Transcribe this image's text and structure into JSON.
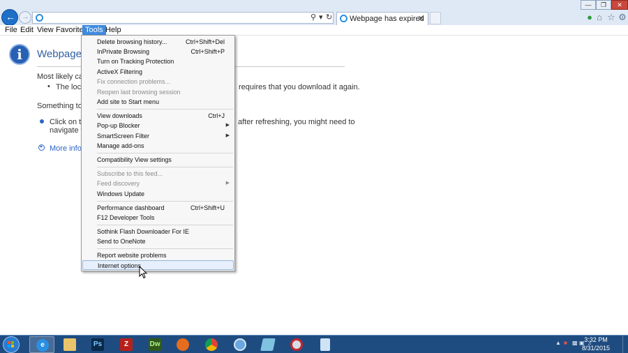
{
  "tab": {
    "title": "Webpage has expired"
  },
  "menubar": {
    "items": [
      {
        "label": "File"
      },
      {
        "label": "Edit"
      },
      {
        "label": "View"
      },
      {
        "label": "Favorites"
      },
      {
        "label": "Tools",
        "active": true
      },
      {
        "label": "Help"
      }
    ]
  },
  "page": {
    "title": "Webpage ha",
    "line1": "Most likely caus",
    "bullet1_left": "The local",
    "bullet1_right": "requires that you download it again.",
    "line2": "Something to t",
    "bullet2_left": "Click on th",
    "bullet2_right": "after refreshing, you might need to",
    "bullet2_line2": "navigate to",
    "more_info": "More infor"
  },
  "tools_menu": {
    "items": [
      {
        "label": "Delete browsing history...",
        "shortcut": "Ctrl+Shift+Del"
      },
      {
        "label": "InPrivate Browsing",
        "shortcut": "Ctrl+Shift+P"
      },
      {
        "label": "Turn on Tracking Protection"
      },
      {
        "label": "ActiveX Filtering"
      },
      {
        "label": "Fix connection problems...",
        "disabled": true
      },
      {
        "label": "Reopen last browsing session",
        "disabled": true
      },
      {
        "label": "Add site to Start menu"
      },
      {
        "label": "View downloads",
        "shortcut": "Ctrl+J"
      },
      {
        "label": "Pop-up Blocker",
        "submenu": true
      },
      {
        "label": "SmartScreen Filter",
        "submenu": true
      },
      {
        "label": "Manage add-ons"
      },
      {
        "label": "Compatibility View settings"
      },
      {
        "label": "Subscribe to this feed...",
        "disabled": true
      },
      {
        "label": "Feed discovery",
        "disabled": true,
        "submenu": true
      },
      {
        "label": "Windows Update"
      },
      {
        "label": "Performance dashboard",
        "shortcut": "Ctrl+Shift+U"
      },
      {
        "label": "F12 Developer Tools"
      },
      {
        "label": "Sothink Flash Downloader For IE"
      },
      {
        "label": "Send to OneNote"
      },
      {
        "label": "Report website problems"
      },
      {
        "label": "Internet options",
        "highlighted": true
      }
    ]
  },
  "taskbar": {
    "apps": [
      {
        "name": "internet-explorer",
        "glyph": "e",
        "color": "#2a8fe0"
      },
      {
        "name": "file-explorer",
        "glyph": "",
        "color": "#e9c46a"
      },
      {
        "name": "photoshop",
        "glyph": "Ps",
        "color": "#0a2a4a"
      },
      {
        "name": "filezilla",
        "glyph": "Z",
        "color": "#b8211b"
      },
      {
        "name": "dreamweaver",
        "glyph": "Dw",
        "color": "#2f5a1b"
      },
      {
        "name": "firefox",
        "glyph": "",
        "color": "#e66c1e"
      },
      {
        "name": "chrome",
        "glyph": "",
        "color": "#2ea44f"
      },
      {
        "name": "safari",
        "glyph": "",
        "color": "#6aa7e0"
      },
      {
        "name": "app-tile",
        "glyph": "",
        "color": "#7fc1e0"
      },
      {
        "name": "media-app",
        "glyph": "",
        "color": "#d8dde3"
      },
      {
        "name": "document",
        "glyph": "",
        "color": "#cfe3f7"
      }
    ],
    "clock_time": "3:32 PM",
    "clock_date": "8/31/2015"
  },
  "colors": {
    "accent": "#3e8ae0",
    "link": "#2c64c4",
    "title": "#2f5fa1"
  }
}
